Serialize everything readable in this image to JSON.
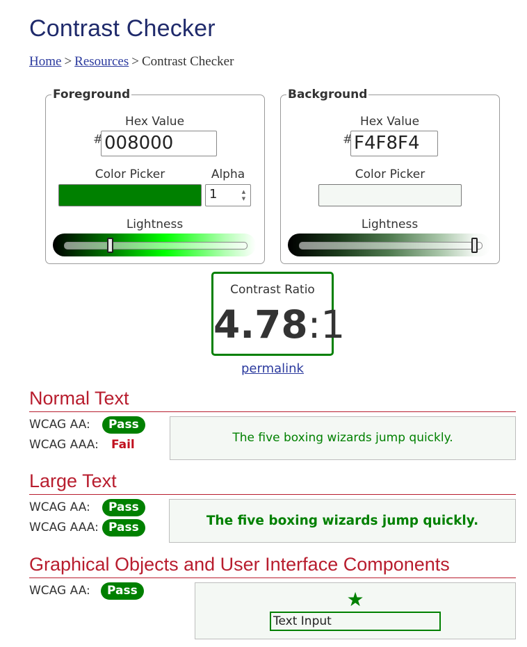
{
  "page": {
    "title": "Contrast Checker",
    "breadcrumb": [
      {
        "label": "Home",
        "link": true
      },
      {
        "label": "Resources",
        "link": true
      },
      {
        "label": "Contrast Checker",
        "link": false
      }
    ],
    "breadcrumb_separator": ">"
  },
  "foreground": {
    "legend": "Foreground",
    "hex_label": "Hex Value",
    "hash": "#",
    "hex_value": "008000",
    "picker_label": "Color Picker",
    "alpha_label": "Alpha",
    "alpha_value": "1",
    "lightness_label": "Lightness",
    "lightness_level": 0.25,
    "color": "#008000"
  },
  "background": {
    "legend": "Background",
    "hex_label": "Hex Value",
    "hash": "#",
    "hex_value": "F4F8F4",
    "picker_label": "Color Picker",
    "lightness_label": "Lightness",
    "lightness_level": 0.96,
    "color": "#F4F8F4"
  },
  "contrast": {
    "label": "Contrast Ratio",
    "value": "4.78",
    "suffix": ":1",
    "permalink": "permalink"
  },
  "sections": {
    "normal": {
      "heading": "Normal Text",
      "aa_label": "WCAG AA:",
      "aa_result": "Pass",
      "aaa_label": "WCAG AAA:",
      "aaa_result": "Fail",
      "sample": "The five boxing wizards jump quickly."
    },
    "large": {
      "heading": "Large Text",
      "aa_label": "WCAG AA:",
      "aa_result": "Pass",
      "aaa_label": "WCAG AAA:",
      "aaa_result": "Pass",
      "sample": "The five boxing wizards jump quickly."
    },
    "graphical": {
      "heading": "Graphical Objects and User Interface Components",
      "aa_label": "WCAG AA:",
      "aa_result": "Pass",
      "star_glyph": "★",
      "text_input": "Text Input"
    }
  },
  "colors": {
    "pass": "#008000",
    "fail": "#C0101E",
    "heading_red": "#B81D2E",
    "title_navy": "#1F2A6B",
    "link_blue": "#2B3A9E"
  }
}
